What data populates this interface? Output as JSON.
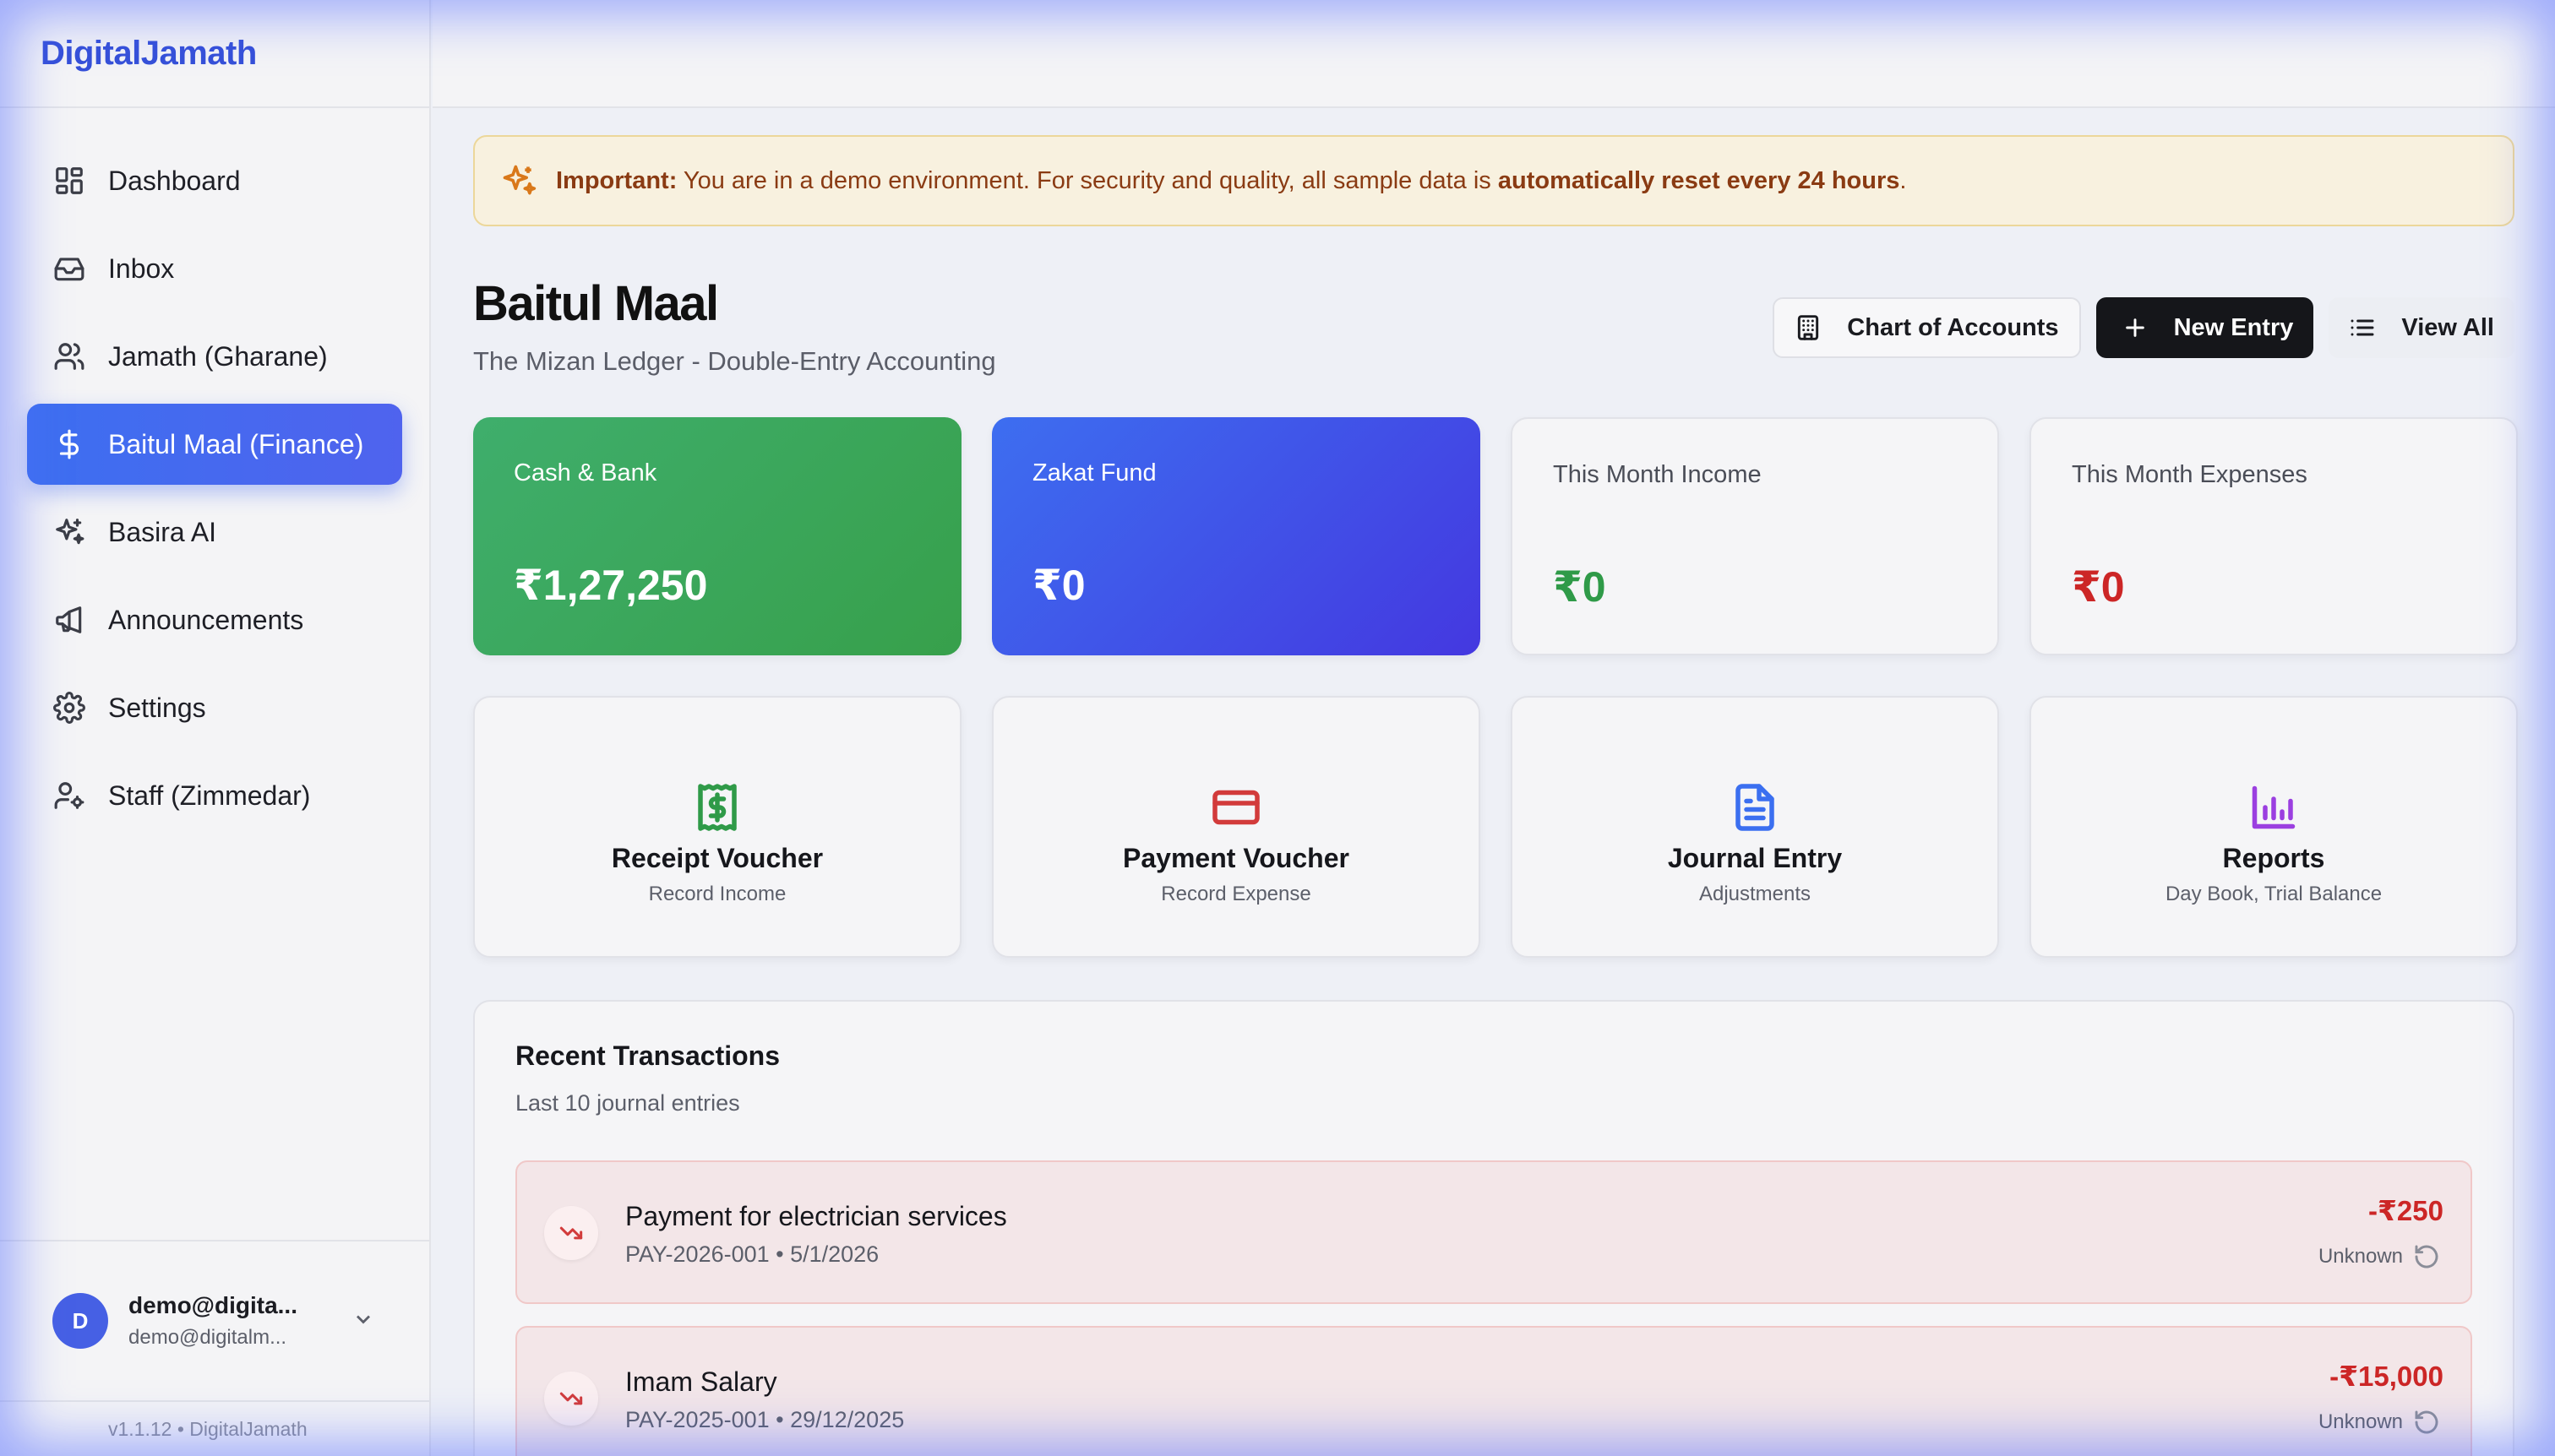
{
  "app": {
    "brand": "DigitalJamath",
    "version": "v1.1.12 • DigitalJamath"
  },
  "sidebar": {
    "items": [
      {
        "label": "Dashboard",
        "icon": "grid-icon"
      },
      {
        "label": "Inbox",
        "icon": "inbox-icon"
      },
      {
        "label": "Jamath (Gharane)",
        "icon": "users-icon"
      },
      {
        "label": "Baitul Maal (Finance)",
        "icon": "dollar-icon",
        "active": true
      },
      {
        "label": "Basira AI",
        "icon": "sparkles-icon"
      },
      {
        "label": "Announcements",
        "icon": "megaphone-icon"
      },
      {
        "label": "Settings",
        "icon": "gear-icon"
      },
      {
        "label": "Staff (Zimmedar)",
        "icon": "user-cog-icon"
      }
    ]
  },
  "user": {
    "initial": "D",
    "name": "demo@digita...",
    "email": "demo@digitalm..."
  },
  "banner": {
    "strong": "Important:",
    "text": " You are in a demo environment. For security and quality, all sample data is ",
    "emphasis": "automatically reset every 24 hours",
    "end": "."
  },
  "page": {
    "title": "Baitul Maal",
    "subtitle": "The Mizan Ledger - Double-Entry Accounting",
    "actions": {
      "chart": "Chart of Accounts",
      "new_entry": "New Entry",
      "view_all": "View All"
    }
  },
  "stats": [
    {
      "label": "Cash & Bank",
      "value": "₹1,27,250"
    },
    {
      "label": "Zakat Fund",
      "value": "₹0"
    },
    {
      "label": "This Month Income",
      "value": "₹0"
    },
    {
      "label": "This Month Expenses",
      "value": "₹0"
    }
  ],
  "quick_actions": [
    {
      "title": "Receipt Voucher",
      "sub": "Record Income",
      "icon": "receipt-icon",
      "color": "#2f9a48"
    },
    {
      "title": "Payment Voucher",
      "sub": "Record Expense",
      "icon": "credit-card-icon",
      "color": "#d23b3b"
    },
    {
      "title": "Journal Entry",
      "sub": "Adjustments",
      "icon": "document-icon",
      "color": "#3b6ff0"
    },
    {
      "title": "Reports",
      "sub": "Day Book, Trial Balance",
      "icon": "bar-chart-icon",
      "color": "#9b3fe0"
    }
  ],
  "recent": {
    "title": "Recent Transactions",
    "subtitle": "Last 10 journal entries",
    "rows": [
      {
        "name": "Payment for electrician services",
        "meta": "PAY-2026-001 • 5/1/2026",
        "amount": "-₹250",
        "status": "Unknown"
      },
      {
        "name": "Imam Salary",
        "meta": "PAY-2025-001 • 29/12/2025",
        "amount": "-₹15,000",
        "status": "Unknown"
      }
    ]
  },
  "colors": {
    "accent": "#3d6ff0",
    "brand": "#3550d8",
    "positive": "#2f9a48",
    "negative": "#cc2626"
  }
}
